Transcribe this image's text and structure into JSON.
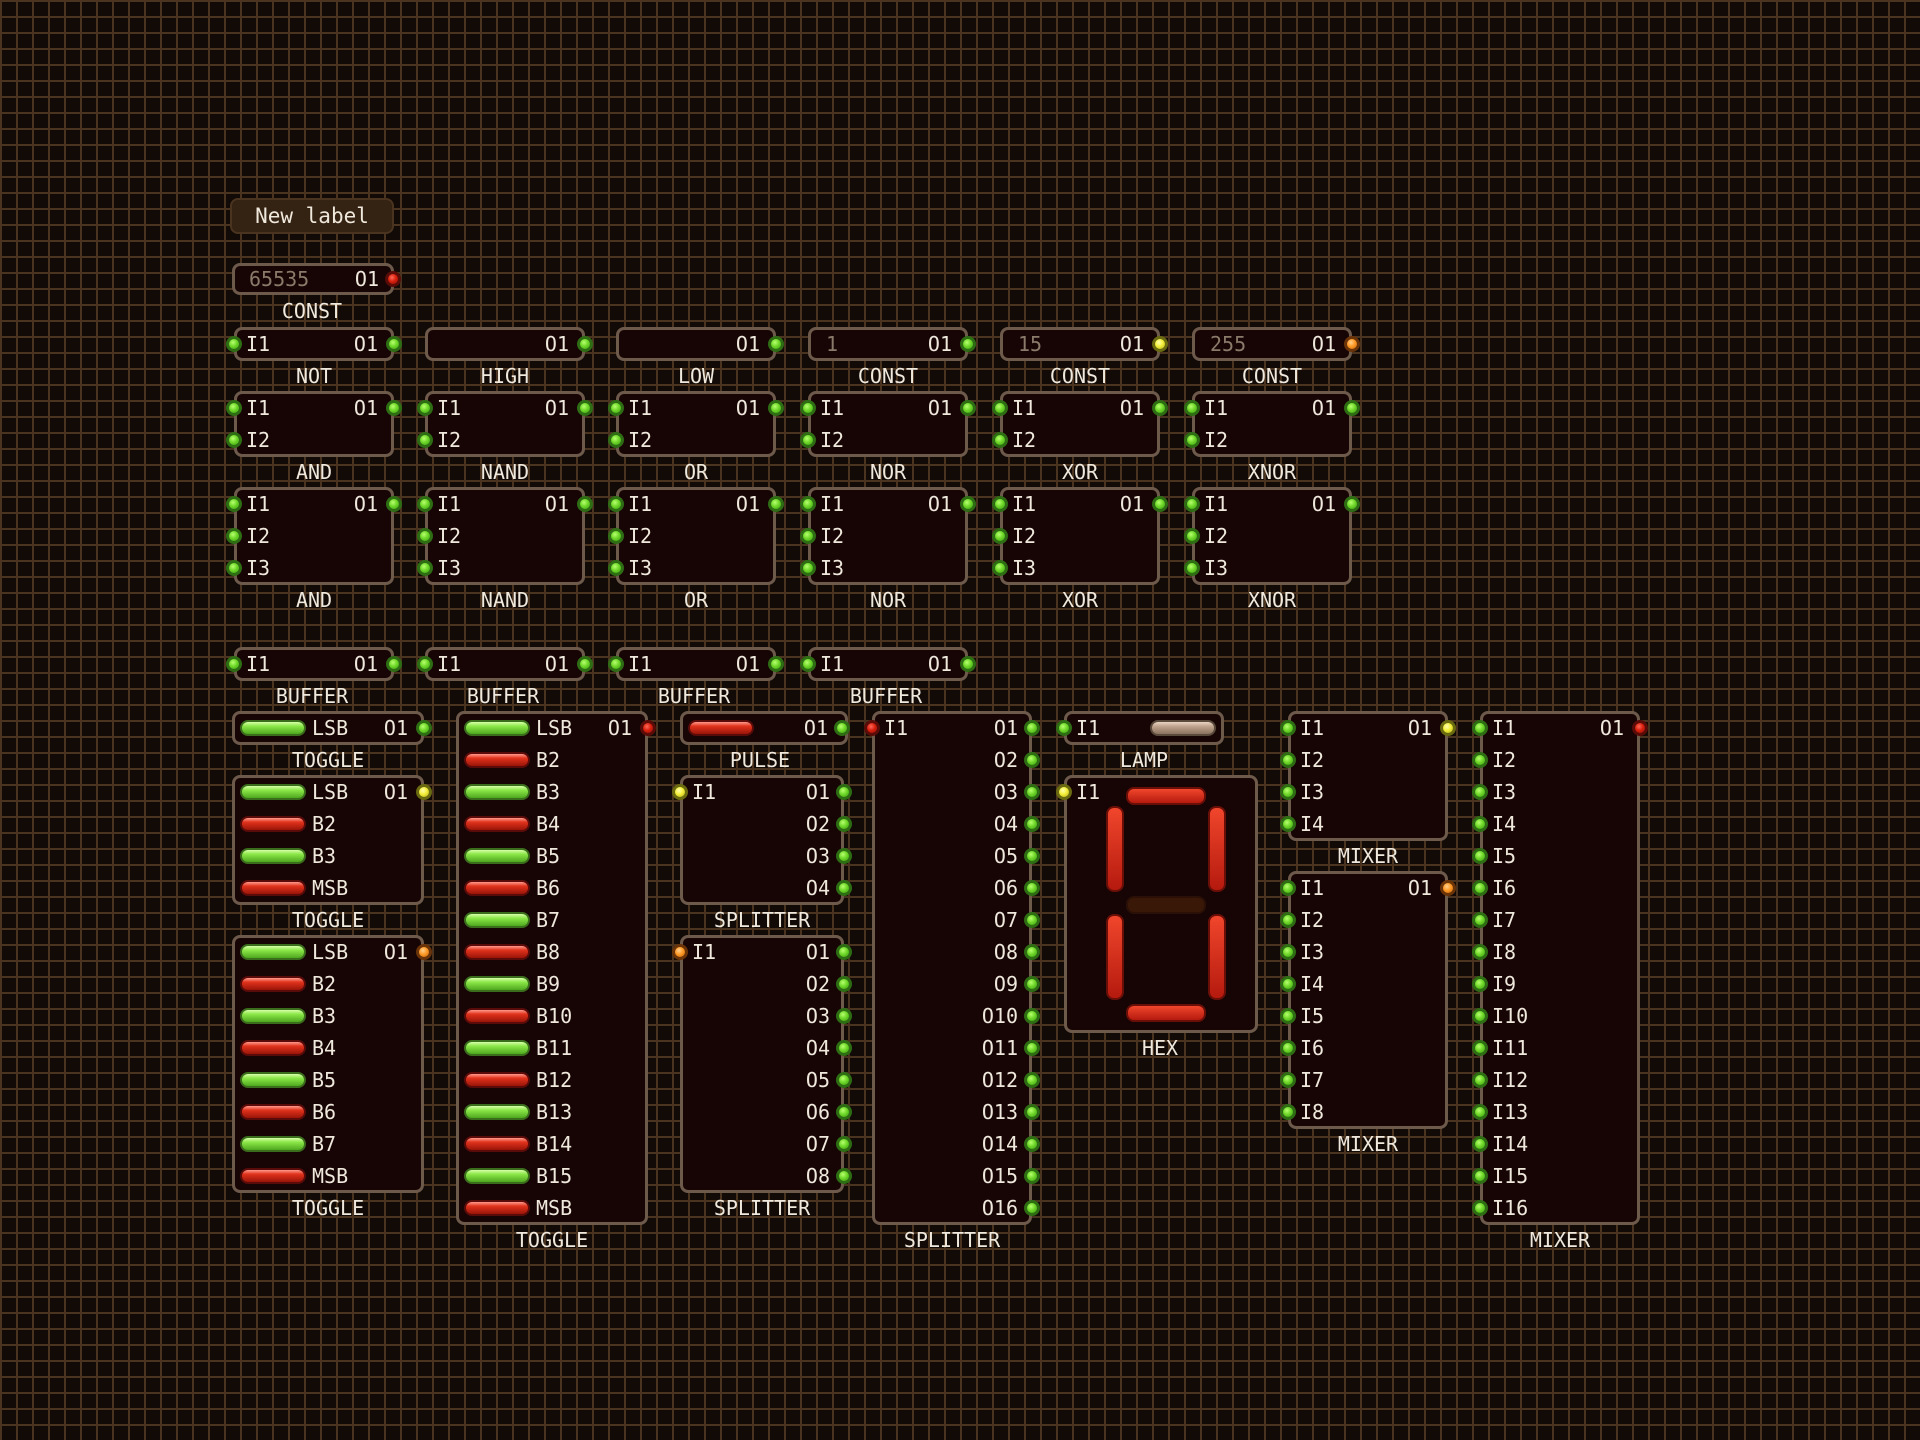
{
  "label_box": {
    "text": "New label"
  },
  "colors": {
    "background": "#110a06",
    "grid_line": "#4a3420",
    "component_fill": "#170405",
    "component_border": "#6e5a4b",
    "text": "#efe8dc",
    "pin_green": "#6ed828",
    "pin_red": "#d8200e",
    "pin_yellow": "#f2ee3a",
    "pin_orange": "#ff9a26",
    "segment_on": "#e03420"
  },
  "const_top": {
    "value": "65535",
    "out": "O1",
    "caption": "CONST",
    "out_state": "red"
  },
  "row1": [
    {
      "caption": "NOT",
      "in": "I1",
      "out": "O1",
      "value": "",
      "out_state": "green"
    },
    {
      "caption": "HIGH",
      "in": "",
      "out": "O1",
      "value": "",
      "out_state": "green"
    },
    {
      "caption": "LOW",
      "in": "",
      "out": "O1",
      "value": "",
      "out_state": "green"
    },
    {
      "caption": "CONST",
      "in": "",
      "out": "O1",
      "value": "1",
      "out_state": "green"
    },
    {
      "caption": "CONST",
      "in": "",
      "out": "O1",
      "value": "15",
      "out_state": "yellow"
    },
    {
      "caption": "CONST",
      "in": "",
      "out": "O1",
      "value": "255",
      "out_state": "orange"
    }
  ],
  "gates2": {
    "inputs": [
      "I1",
      "I2"
    ],
    "out": "O1",
    "captions": [
      "AND",
      "NAND",
      "OR",
      "NOR",
      "XOR",
      "XNOR"
    ]
  },
  "gates3": {
    "inputs": [
      "I1",
      "I2",
      "I3"
    ],
    "out": "O1",
    "captions": [
      "AND",
      "NAND",
      "OR",
      "NOR",
      "XOR",
      "XNOR"
    ]
  },
  "buffers": {
    "in": "I1",
    "out": "O1",
    "caption": "BUFFER",
    "count": 4
  },
  "toggle1": {
    "caption": "TOGGLE",
    "out": "O1",
    "out_state": "green",
    "bits": [
      {
        "label": "LSB",
        "on": true
      }
    ]
  },
  "toggle4": {
    "caption": "TOGGLE",
    "out": "O1",
    "out_state": "yellow",
    "bits": [
      {
        "label": "LSB",
        "on": true
      },
      {
        "label": "B2",
        "on": false
      },
      {
        "label": "B3",
        "on": true
      },
      {
        "label": "MSB",
        "on": false
      }
    ]
  },
  "toggle8": {
    "caption": "TOGGLE",
    "out": "O1",
    "out_state": "orange",
    "bits": [
      {
        "label": "LSB",
        "on": true
      },
      {
        "label": "B2",
        "on": false
      },
      {
        "label": "B3",
        "on": true
      },
      {
        "label": "B4",
        "on": false
      },
      {
        "label": "B5",
        "on": true
      },
      {
        "label": "B6",
        "on": false
      },
      {
        "label": "B7",
        "on": true
      },
      {
        "label": "MSB",
        "on": false
      }
    ]
  },
  "toggle16": {
    "caption": "TOGGLE",
    "out": "O1",
    "out_state": "red",
    "bits": [
      {
        "label": "LSB",
        "on": true
      },
      {
        "label": "B2",
        "on": false
      },
      {
        "label": "B3",
        "on": true
      },
      {
        "label": "B4",
        "on": false
      },
      {
        "label": "B5",
        "on": true
      },
      {
        "label": "B6",
        "on": false
      },
      {
        "label": "B7",
        "on": true
      },
      {
        "label": "B8",
        "on": false
      },
      {
        "label": "B9",
        "on": true
      },
      {
        "label": "B10",
        "on": false
      },
      {
        "label": "B11",
        "on": true
      },
      {
        "label": "B12",
        "on": false
      },
      {
        "label": "B13",
        "on": true
      },
      {
        "label": "B14",
        "on": false
      },
      {
        "label": "B15",
        "on": true
      },
      {
        "label": "MSB",
        "on": false
      }
    ]
  },
  "pulse": {
    "caption": "PULSE",
    "out": "O1",
    "on": false
  },
  "splitter4": {
    "caption": "SPLITTER",
    "in": "I1",
    "in_state": "yellow",
    "outputs": [
      "O1",
      "O2",
      "O3",
      "O4"
    ]
  },
  "splitter8": {
    "caption": "SPLITTER",
    "in": "I1",
    "in_state": "orange",
    "outputs": [
      "O1",
      "O2",
      "O3",
      "O4",
      "O5",
      "O6",
      "O7",
      "O8"
    ]
  },
  "splitter16": {
    "caption": "SPLITTER",
    "in": "I1",
    "in_state": "red",
    "outputs": [
      "O1",
      "O2",
      "O3",
      "O4",
      "O5",
      "O6",
      "O7",
      "O8",
      "O9",
      "O10",
      "O11",
      "O12",
      "O13",
      "O14",
      "O15",
      "O16"
    ]
  },
  "lamp": {
    "caption": "LAMP",
    "in": "I1",
    "on": false
  },
  "hex": {
    "caption": "HEX",
    "in": "I1",
    "in_state": "yellow",
    "segments": {
      "a": true,
      "b": true,
      "c": true,
      "d": true,
      "e": true,
      "f": true,
      "g": false
    }
  },
  "mixer4": {
    "caption": "MIXER",
    "out": "O1",
    "out_state": "yellow",
    "inputs": [
      "I1",
      "I2",
      "I3",
      "I4"
    ]
  },
  "mixer8": {
    "caption": "MIXER",
    "out": "O1",
    "out_state": "orange",
    "inputs": [
      "I1",
      "I2",
      "I3",
      "I4",
      "I5",
      "I6",
      "I7",
      "I8"
    ]
  },
  "mixer16": {
    "caption": "MIXER",
    "out": "O1",
    "out_state": "red",
    "inputs": [
      "I1",
      "I2",
      "I3",
      "I4",
      "I5",
      "I6",
      "I7",
      "I8",
      "I9",
      "I10",
      "I11",
      "I12",
      "I13",
      "I14",
      "I15",
      "I16"
    ]
  }
}
